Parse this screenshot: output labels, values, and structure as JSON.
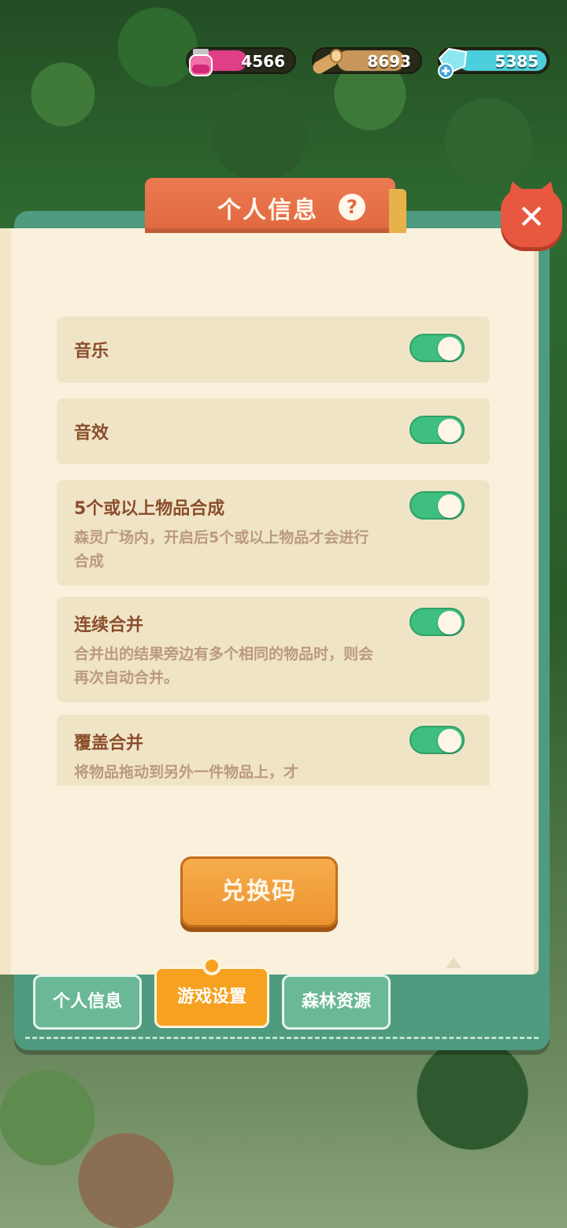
{
  "resources": {
    "ink": {
      "value": "4566",
      "icon": "ink-bottle-icon",
      "color": "#e03f88"
    },
    "wood": {
      "value": "8693",
      "icon": "wood-log-icon",
      "color": "#c8965a"
    },
    "gem": {
      "value": "5385",
      "icon": "gem-plus-icon",
      "color": "#4ccfdc"
    }
  },
  "dialog": {
    "title": "个人信息",
    "help": "?",
    "close": "✕"
  },
  "settings": [
    {
      "label": "音乐",
      "description": "",
      "enabled": true
    },
    {
      "label": "音效",
      "description": "",
      "enabled": true
    },
    {
      "label": "5个或以上物品合成",
      "description": "森灵广场内，开启后5个或以上物品才会进行合成",
      "enabled": true
    },
    {
      "label": "连续合并",
      "description": "合并出的结果旁边有多个相同的物品时，则会再次自动合并。",
      "enabled": true
    },
    {
      "label": "覆盖合并",
      "description": "将物品拖动到另外一件物品上，才",
      "enabled": true
    }
  ],
  "redeem_button": "兑换码",
  "tabs": [
    {
      "label": "个人信息",
      "active": false
    },
    {
      "label": "游戏设置",
      "active": true
    },
    {
      "label": "森林资源",
      "active": false
    }
  ],
  "colors": {
    "accent_orange": "#e0683f",
    "toggle_green": "#3fbf7f",
    "panel_teal": "#4e9b7f",
    "paper": "#faf1dd"
  }
}
